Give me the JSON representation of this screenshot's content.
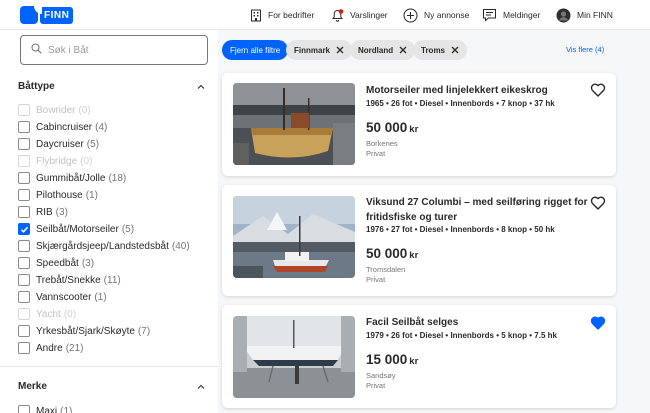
{
  "header": {
    "logo_text": "FINN",
    "nav": [
      {
        "label": "For bedrifter",
        "icon": "building-icon"
      },
      {
        "label": "Varslinger",
        "icon": "bell-icon"
      },
      {
        "label": "Ny annonse",
        "icon": "plus-circle-icon"
      },
      {
        "label": "Meldinger",
        "icon": "chat-icon"
      },
      {
        "label": "Min FINN",
        "icon": "avatar"
      }
    ],
    "accent": "#0063fb",
    "notification_dot": "#d91f0a"
  },
  "search": {
    "placeholder": "Søk i Båt",
    "value": ""
  },
  "filters": {
    "battype_title": "Båttype",
    "battype": [
      {
        "label": "Bowrider",
        "count": "(0)",
        "checked": false,
        "disabled": true
      },
      {
        "label": "Cabincruiser",
        "count": "(4)",
        "checked": false,
        "disabled": false
      },
      {
        "label": "Daycruiser",
        "count": "(5)",
        "checked": false,
        "disabled": false
      },
      {
        "label": "Flybridge",
        "count": "(0)",
        "checked": false,
        "disabled": true
      },
      {
        "label": "Gummibåt/Jolle",
        "count": "(18)",
        "checked": false,
        "disabled": false
      },
      {
        "label": "Pilothouse",
        "count": "(1)",
        "checked": false,
        "disabled": false
      },
      {
        "label": "RIB",
        "count": "(3)",
        "checked": false,
        "disabled": false
      },
      {
        "label": "Seilbåt/Motorseiler",
        "count": "(5)",
        "checked": true,
        "disabled": false
      },
      {
        "label": "Skjærgårdsjeep/Landstedsbåt",
        "count": "(40)",
        "checked": false,
        "disabled": false
      },
      {
        "label": "Speedbåt",
        "count": "(3)",
        "checked": false,
        "disabled": false
      },
      {
        "label": "Trebåt/Snekke",
        "count": "(11)",
        "checked": false,
        "disabled": false
      },
      {
        "label": "Vannscooter",
        "count": "(1)",
        "checked": false,
        "disabled": false
      },
      {
        "label": "Yacht",
        "count": "(0)",
        "checked": false,
        "disabled": true
      },
      {
        "label": "Yrkesbåt/Sjark/Skøyte",
        "count": "(7)",
        "checked": false,
        "disabled": false
      },
      {
        "label": "Andre",
        "count": "(21)",
        "checked": false,
        "disabled": false
      }
    ],
    "merke_title": "Merke",
    "merke": [
      {
        "label": "Maxi",
        "count": "(1)",
        "checked": false,
        "disabled": false
      }
    ]
  },
  "chips": {
    "clear_all": "Fjern alle filtre",
    "active": [
      "Finnmark",
      "Nordland",
      "Troms"
    ],
    "show_more": "Vis flere (4)"
  },
  "listings": [
    {
      "title": "Motorseiler med linjelekkert eikeskrog",
      "specs": "1965 • 26 fot • Diesel • Innenbords • 7 knop • 37 hk",
      "price": "50 000",
      "currency": "kr",
      "location": "Borkenes",
      "seller": "Privat",
      "favorited": false
    },
    {
      "title": "Viksund 27 Columbi – med seilføring rigget for fritidsfiske og turer",
      "specs": "1976 • 27 fot • Diesel • Innenbords • 8 knop • 50 hk",
      "price": "50 000",
      "currency": "kr",
      "location": "Tromsdalen",
      "seller": "Privat",
      "favorited": false
    },
    {
      "title": "Facil Seilbåt selges",
      "specs": "1979 • 26 fot • Diesel • Innenbords • 5 knop • 7.5 hk",
      "price": "15 000",
      "currency": "kr",
      "location": "Sandsøy",
      "seller": "Privat",
      "favorited": true
    }
  ]
}
